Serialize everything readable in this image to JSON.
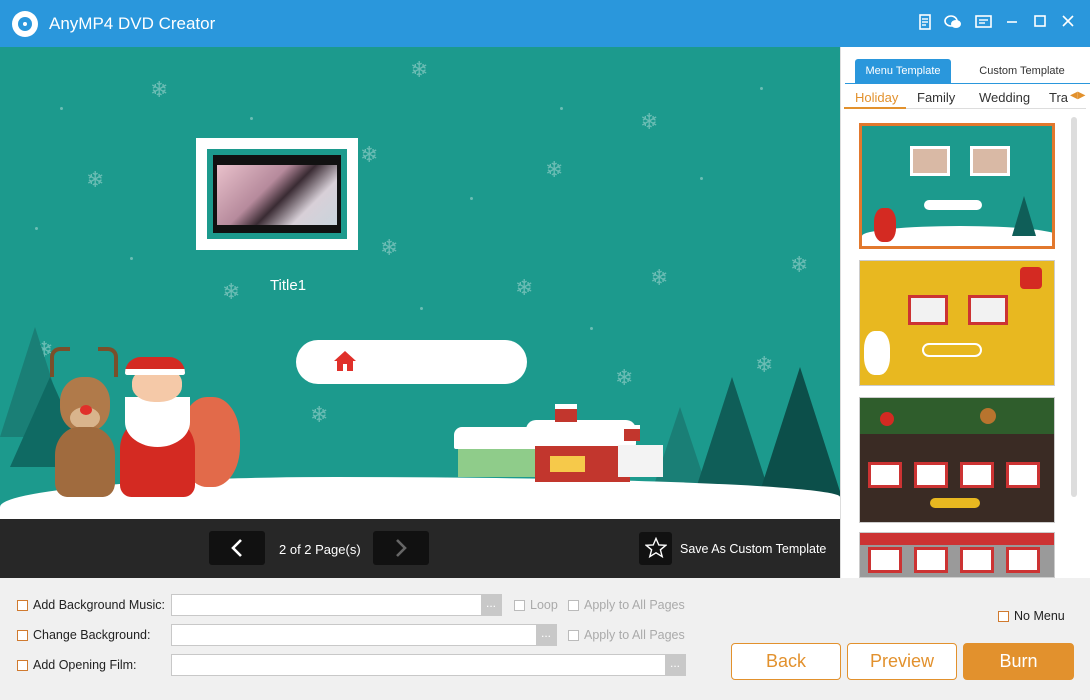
{
  "app": {
    "title": "AnyMP4 DVD Creator"
  },
  "titlebar_icons": [
    "document-icon",
    "chat-icon",
    "menu-list-icon",
    "minimize-icon",
    "maximize-icon",
    "close-icon"
  ],
  "preview": {
    "title_label": "Title1"
  },
  "pager": {
    "page_text": "2 of 2 Page(s)",
    "save_template_label": "Save As Custom Template"
  },
  "template_panel": {
    "tabs": [
      {
        "label": "Menu Template",
        "active": true
      },
      {
        "label": "Custom Template",
        "active": false
      }
    ],
    "categories": [
      "Holiday",
      "Family",
      "Wedding",
      "Tra"
    ],
    "selected_category": "Holiday",
    "selected_template_index": 0
  },
  "options": {
    "background_music": {
      "label": "Add Background Music:",
      "value": "",
      "loop_label": "Loop",
      "apply_all_label": "Apply to All Pages",
      "checked": false
    },
    "change_background": {
      "label": "Change Background:",
      "value": "",
      "apply_all_label": "Apply to All Pages",
      "checked": false
    },
    "opening_film": {
      "label": "Add Opening Film:",
      "value": "",
      "checked": false
    },
    "browse_label": "...",
    "no_menu": {
      "label": "No Menu",
      "checked": false
    }
  },
  "buttons": {
    "back": "Back",
    "preview": "Preview",
    "burn": "Burn"
  },
  "colors": {
    "accent": "#e2912d",
    "titlebar": "#2a97dc",
    "preview_bg": "#1c9a8d",
    "pager_bg": "#272727"
  }
}
